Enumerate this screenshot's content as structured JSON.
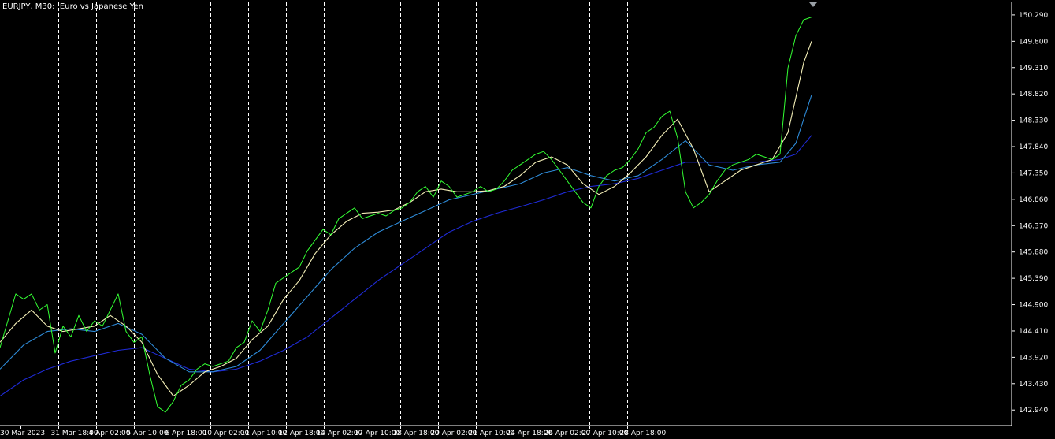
{
  "window": {
    "title_symbol": "EURJPY, M30:",
    "title_description": "Euro vs Japanese Yen"
  },
  "colors": {
    "background": "#000000",
    "axis": "#ffffff",
    "grid": "#ffffff",
    "price": "#33ff33",
    "ma_fast": "#f5f0b8",
    "ma_mid": "#2e8bd8",
    "ma_slow": "#1f2bd6"
  },
  "chart_data": {
    "type": "line",
    "title": "EURJPY, M30:  Euro vs Japanese Yen",
    "ylim": [
      142.65,
      150.45
    ],
    "y_ticks": [
      "150.290",
      "149.800",
      "149.310",
      "148.820",
      "148.330",
      "147.840",
      "147.350",
      "146.860",
      "146.370",
      "145.880",
      "145.390",
      "144.900",
      "144.410",
      "143.920",
      "143.430",
      "142.940"
    ],
    "x_ticks": [
      "30 Mar 2023",
      "31 Mar 18:00",
      "4 Apr 02:00",
      "5 Apr 10:00",
      "6 Apr 18:00",
      "10 Apr 02:00",
      "11 Apr 10:00",
      "12 Apr 18:00",
      "14 Apr 02:00",
      "17 Apr 10:00",
      "18 Apr 18:00",
      "20 Apr 02:00",
      "21 Apr 10:00",
      "24 Apr 18:00",
      "26 Apr 02:00",
      "27 Apr 10:00",
      "28 Apr 18:00"
    ],
    "x_range": [
      0,
      1035
    ],
    "grid": "vertical dashed at each x tick",
    "series": [
      {
        "name": "",
        "role": "price",
        "color": "#33ff33",
        "x": [
          0,
          10,
          20,
          30,
          40,
          50,
          60,
          70,
          80,
          90,
          100,
          110,
          120,
          130,
          140,
          150,
          160,
          170,
          180,
          190,
          200,
          210,
          220,
          230,
          240,
          250,
          260,
          270,
          280,
          290,
          300,
          310,
          320,
          330,
          340,
          350,
          360,
          370,
          380,
          390,
          400,
          410,
          420,
          430,
          440,
          450,
          460,
          470,
          480,
          490,
          500,
          510,
          520,
          530,
          540,
          550,
          560,
          570,
          580,
          590,
          600,
          610,
          620,
          630,
          640,
          650,
          660,
          670,
          680,
          690,
          700,
          710,
          720,
          730,
          740,
          750,
          760,
          770,
          780,
          790,
          800,
          810,
          820,
          830,
          840,
          850,
          860,
          870,
          880,
          890,
          900,
          910,
          920,
          930,
          940,
          950,
          960,
          970,
          980,
          990,
          1000,
          1010,
          1020,
          1030
        ],
        "values": [
          144.1,
          144.6,
          145.1,
          145.0,
          145.1,
          144.8,
          144.9,
          144.0,
          144.5,
          144.3,
          144.7,
          144.4,
          144.6,
          144.5,
          144.8,
          145.1,
          144.4,
          144.2,
          144.3,
          143.6,
          143.0,
          142.9,
          143.1,
          143.4,
          143.5,
          143.7,
          143.8,
          143.75,
          143.8,
          143.85,
          144.1,
          144.2,
          144.6,
          144.4,
          144.8,
          145.3,
          145.4,
          145.5,
          145.6,
          145.9,
          146.1,
          146.3,
          146.2,
          146.5,
          146.6,
          146.7,
          146.5,
          146.55,
          146.6,
          146.55,
          146.65,
          146.7,
          146.8,
          147.0,
          147.1,
          146.9,
          147.2,
          147.1,
          146.9,
          146.95,
          147.0,
          147.1,
          147.0,
          147.05,
          147.2,
          147.4,
          147.5,
          147.6,
          147.7,
          147.75,
          147.6,
          147.4,
          147.2,
          147.0,
          146.8,
          146.7,
          147.1,
          147.3,
          147.4,
          147.45,
          147.6,
          147.8,
          148.1,
          148.2,
          148.4,
          148.5,
          148.0,
          147.0,
          146.7,
          146.8,
          146.95,
          147.2,
          147.4,
          147.5,
          147.55,
          147.6,
          147.7,
          147.65,
          147.6,
          147.7,
          149.3,
          149.9,
          150.2,
          150.25
        ]
      },
      {
        "name": "",
        "role": "ma-fast",
        "color": "#f5f0b8",
        "x": [
          0,
          20,
          40,
          60,
          80,
          100,
          120,
          140,
          160,
          180,
          200,
          220,
          240,
          260,
          280,
          300,
          320,
          340,
          360,
          380,
          400,
          420,
          440,
          460,
          480,
          500,
          520,
          540,
          560,
          580,
          600,
          620,
          640,
          660,
          680,
          700,
          720,
          740,
          760,
          780,
          800,
          820,
          840,
          860,
          880,
          900,
          920,
          940,
          960,
          980,
          1000,
          1020,
          1030
        ],
        "values": [
          144.2,
          144.55,
          144.8,
          144.5,
          144.4,
          144.45,
          144.5,
          144.7,
          144.5,
          144.2,
          143.6,
          143.2,
          143.4,
          143.65,
          143.75,
          143.9,
          144.25,
          144.5,
          145.0,
          145.35,
          145.85,
          146.2,
          146.45,
          146.6,
          146.62,
          146.66,
          146.8,
          147.0,
          147.05,
          147.0,
          147.0,
          147.02,
          147.1,
          147.3,
          147.55,
          147.65,
          147.5,
          147.15,
          146.95,
          147.1,
          147.35,
          147.65,
          148.05,
          148.35,
          147.8,
          147.0,
          147.2,
          147.4,
          147.5,
          147.6,
          148.1,
          149.4,
          149.8
        ]
      },
      {
        "name": "",
        "role": "ma-mid",
        "color": "#2e8bd8",
        "x": [
          0,
          30,
          60,
          90,
          120,
          150,
          180,
          210,
          240,
          270,
          300,
          330,
          360,
          390,
          420,
          450,
          480,
          510,
          540,
          570,
          600,
          630,
          660,
          690,
          720,
          750,
          780,
          810,
          840,
          870,
          900,
          930,
          960,
          990,
          1010,
          1030
        ],
        "values": [
          143.7,
          144.15,
          144.4,
          144.45,
          144.4,
          144.55,
          144.35,
          143.9,
          143.65,
          143.65,
          143.75,
          144.05,
          144.55,
          145.05,
          145.55,
          145.95,
          146.25,
          146.45,
          146.65,
          146.85,
          146.95,
          147.05,
          147.15,
          147.35,
          147.45,
          147.3,
          147.2,
          147.3,
          147.6,
          147.95,
          147.5,
          147.4,
          147.5,
          147.55,
          147.9,
          148.8
        ]
      },
      {
        "name": "",
        "role": "ma-slow",
        "color": "#1f2bd6",
        "x": [
          0,
          30,
          60,
          90,
          120,
          150,
          180,
          210,
          240,
          270,
          300,
          330,
          360,
          390,
          420,
          450,
          480,
          510,
          540,
          570,
          600,
          630,
          660,
          690,
          720,
          750,
          780,
          810,
          840,
          870,
          900,
          930,
          960,
          990,
          1010,
          1030
        ],
        "values": [
          143.2,
          143.5,
          143.7,
          143.85,
          143.95,
          144.05,
          144.1,
          143.9,
          143.7,
          143.65,
          143.7,
          143.85,
          144.05,
          144.3,
          144.65,
          145.0,
          145.35,
          145.65,
          145.95,
          146.25,
          146.45,
          146.6,
          146.72,
          146.85,
          147.0,
          147.1,
          147.15,
          147.25,
          147.4,
          147.55,
          147.55,
          147.55,
          147.55,
          147.6,
          147.7,
          148.05
        ]
      }
    ]
  }
}
